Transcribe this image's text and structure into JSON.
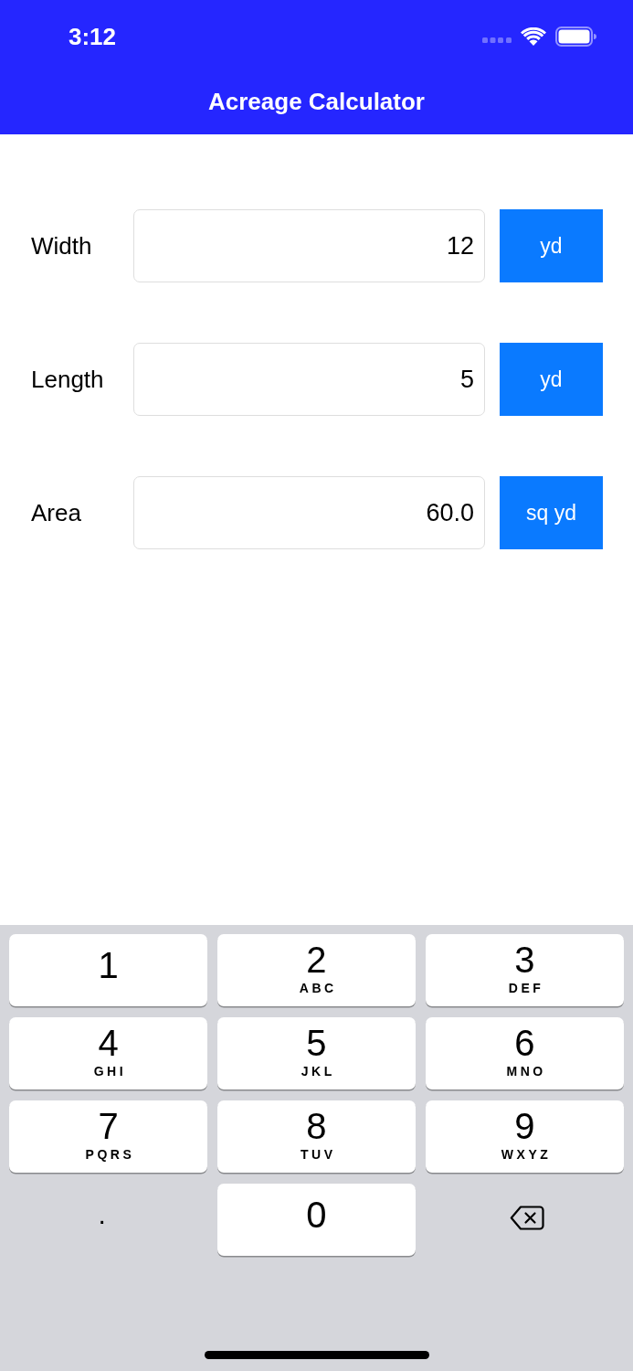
{
  "status_bar": {
    "time": "3:12"
  },
  "nav_bar": {
    "title": "Acreage Calculator"
  },
  "fields": [
    {
      "label": "Width",
      "value": "12",
      "unit": "yd"
    },
    {
      "label": "Length",
      "value": "5",
      "unit": "yd"
    },
    {
      "label": "Area",
      "value": "60.0",
      "unit": "sq yd"
    }
  ],
  "keypad": {
    "rows": [
      {
        "keys": [
          {
            "kind": "digit",
            "digit": "1"
          },
          {
            "kind": "digit",
            "digit": "2",
            "letters": "ABC"
          },
          {
            "kind": "digit",
            "digit": "3",
            "letters": "DEF"
          }
        ]
      },
      {
        "keys": [
          {
            "kind": "digit",
            "digit": "4",
            "letters": "GHI"
          },
          {
            "kind": "digit",
            "digit": "5",
            "letters": "JKL"
          },
          {
            "kind": "digit",
            "digit": "6",
            "letters": "MNO"
          }
        ]
      },
      {
        "keys": [
          {
            "kind": "digit",
            "digit": "7",
            "letters": "PQRS"
          },
          {
            "kind": "digit",
            "digit": "8",
            "letters": "TUV"
          },
          {
            "kind": "digit",
            "digit": "9",
            "letters": "WXYZ"
          }
        ]
      },
      {
        "keys": [
          {
            "kind": "symbol",
            "symbol": "."
          },
          {
            "kind": "digit",
            "digit": "0"
          },
          {
            "kind": "delete"
          }
        ]
      }
    ]
  }
}
